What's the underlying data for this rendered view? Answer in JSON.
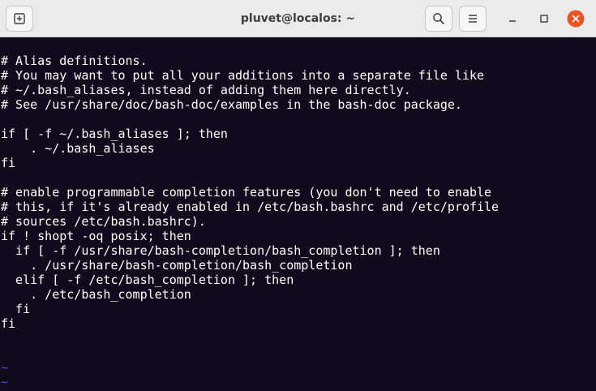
{
  "window": {
    "title": "pluvet@localos: ~"
  },
  "icons": {
    "new_tab": "new-tab-icon",
    "search": "search-icon",
    "menu": "hamburger-menu-icon",
    "minimize": "minimize-icon",
    "maximize": "maximize-icon",
    "close": "close-icon"
  },
  "colors": {
    "terminal_bg": "#13091c",
    "text": "#ffffff",
    "tilde": "#4a59c9",
    "close_button": "#e95420"
  },
  "terminal": {
    "lines": [
      "# Alias definitions.",
      "# You may want to put all your additions into a separate file like",
      "# ~/.bash_aliases, instead of adding them here directly.",
      "# See /usr/share/doc/bash-doc/examples in the bash-doc package.",
      "",
      "if [ -f ~/.bash_aliases ]; then",
      "    . ~/.bash_aliases",
      "fi",
      "",
      "# enable programmable completion features (you don't need to enable",
      "# this, if it's already enabled in /etc/bash.bashrc and /etc/profile",
      "# sources /etc/bash.bashrc).",
      "if ! shopt -oq posix; then",
      "  if [ -f /usr/share/bash-completion/bash_completion ]; then",
      "    . /usr/share/bash-completion/bash_completion",
      "  elif [ -f /etc/bash_completion ]; then",
      "    . /etc/bash_completion",
      "  fi",
      "fi",
      "",
      "",
      "~",
      "~"
    ]
  }
}
